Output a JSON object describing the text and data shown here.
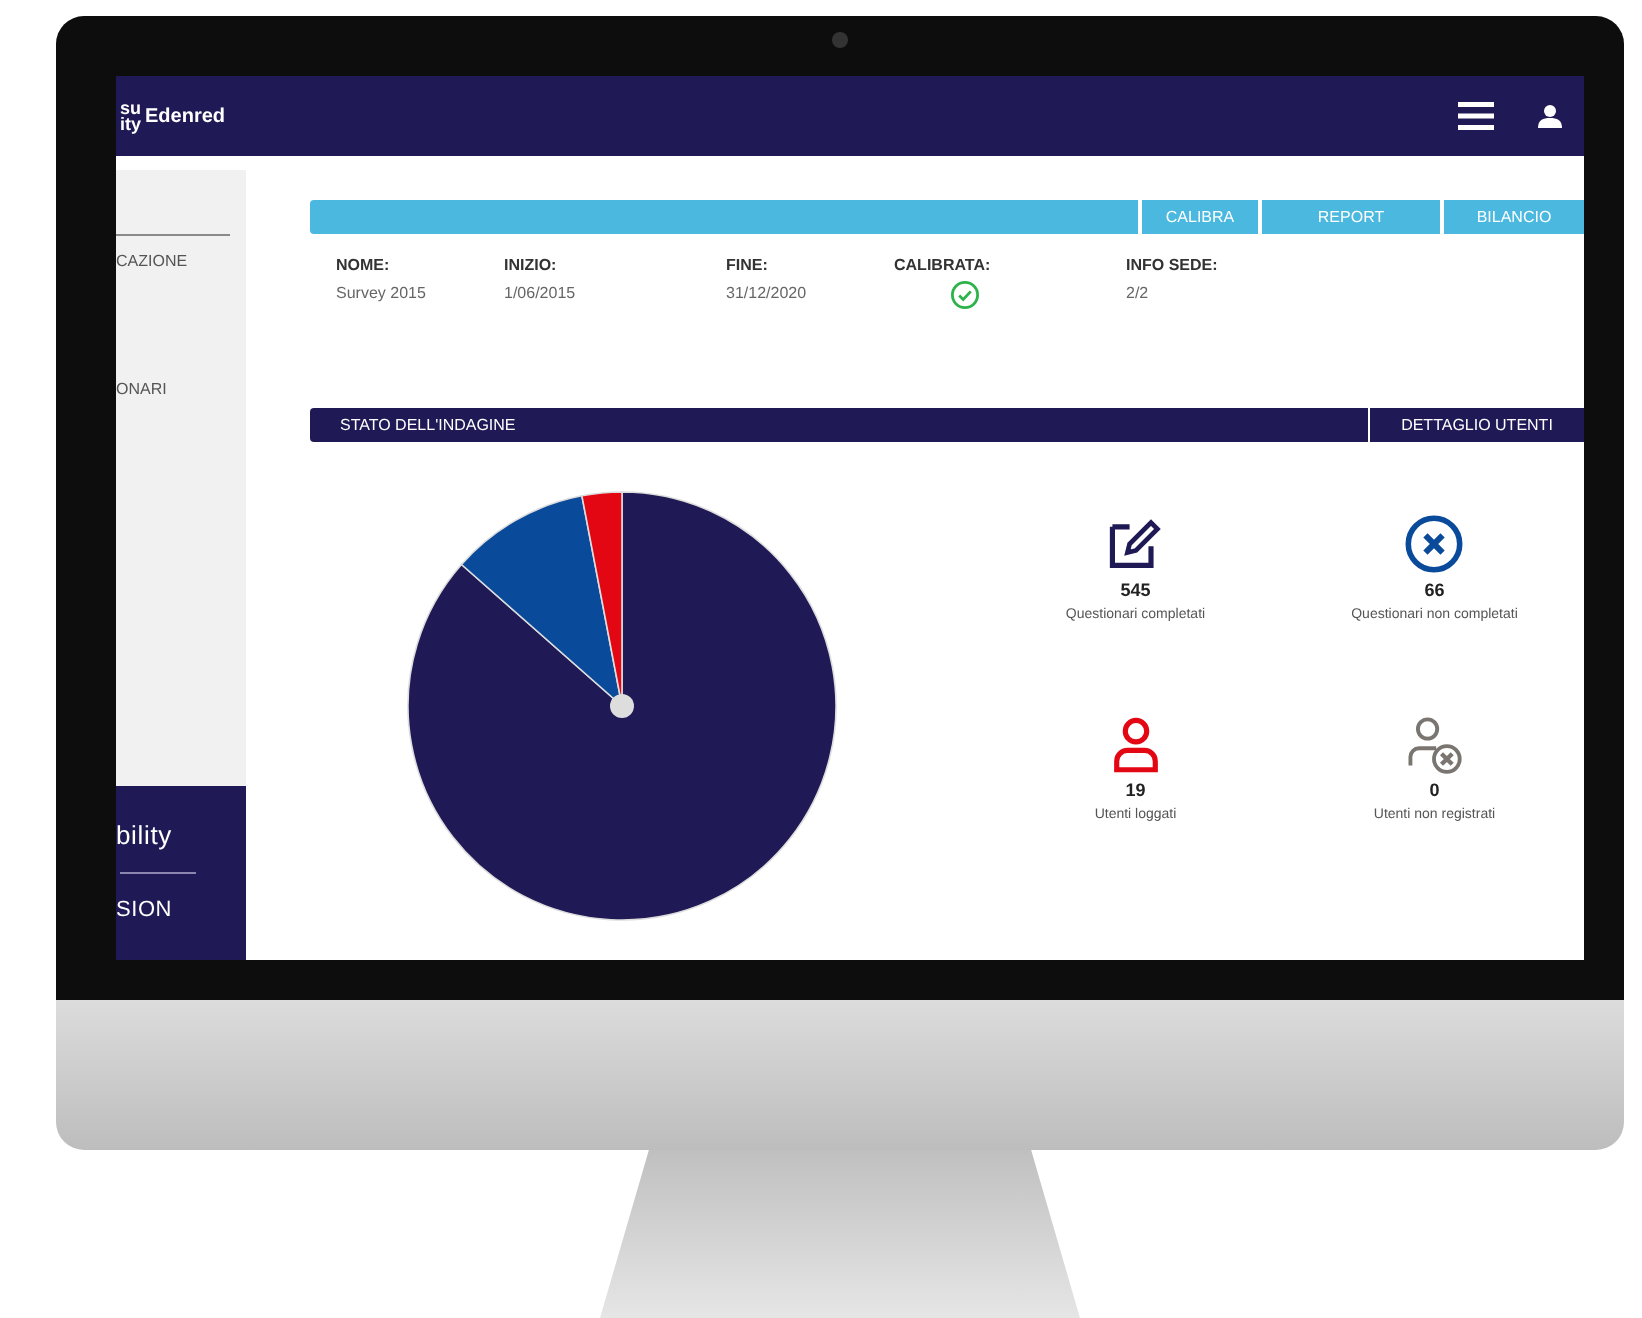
{
  "header": {
    "logo_lines": [
      "su",
      "ity"
    ],
    "brand": "Edenred"
  },
  "sidebar": {
    "items": [
      {
        "label": "CAZIONE"
      },
      {
        "label": "ONARI"
      }
    ],
    "footer": {
      "title": "bility",
      "subtitle": "SION"
    }
  },
  "toolbar": {
    "buttons": [
      "CALIBRA",
      "REPORT",
      "BILANCIO"
    ]
  },
  "info": [
    {
      "kind": "text",
      "label": "NOME:",
      "value": "Survey 2015"
    },
    {
      "kind": "text",
      "label": "INIZIO:",
      "value": "1/06/2015"
    },
    {
      "kind": "text",
      "label": "FINE:",
      "value": "31/12/2020"
    },
    {
      "kind": "check",
      "label": "CALIBRATA:",
      "checked": true
    },
    {
      "kind": "text",
      "label": "INFO SEDE:",
      "value": "2/2"
    }
  ],
  "status": {
    "title": "STATO DELL'INDAGINE",
    "button": "DETTAGLIO UTENTI"
  },
  "stats": [
    {
      "kind": "edit",
      "color": "#1f1a55",
      "value": "545",
      "label": "Questionari completati"
    },
    {
      "kind": "x-circle",
      "color": "#0a4a9a",
      "value": "66",
      "label": "Questionari non completati"
    },
    {
      "kind": "user",
      "color": "#e30613",
      "value": "19",
      "label": "Utenti loggati"
    },
    {
      "kind": "user-x",
      "color": "#7a7570",
      "value": "0",
      "label": "Utenti non registrati"
    }
  ]
}
